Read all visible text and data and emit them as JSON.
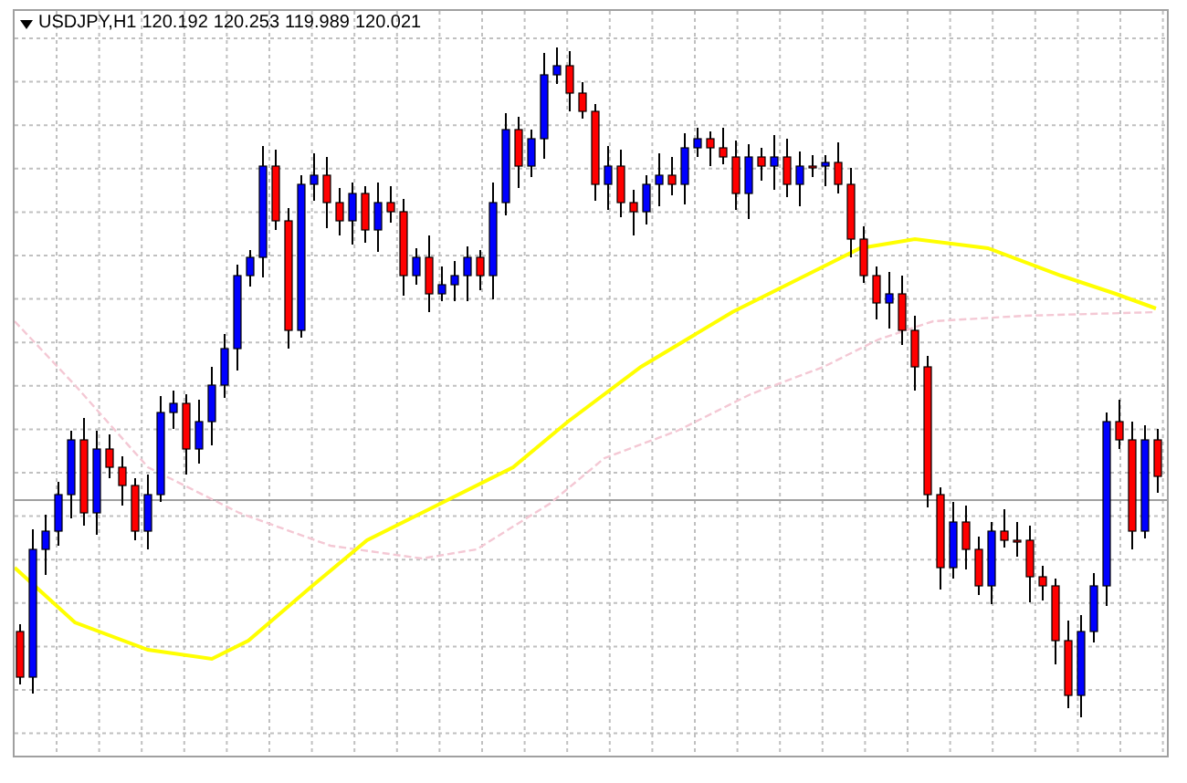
{
  "chart": {
    "symbol": "USDJPY,H1",
    "prices": [
      "120.192",
      "120.253",
      "119.989",
      "120.021"
    ]
  }
}
